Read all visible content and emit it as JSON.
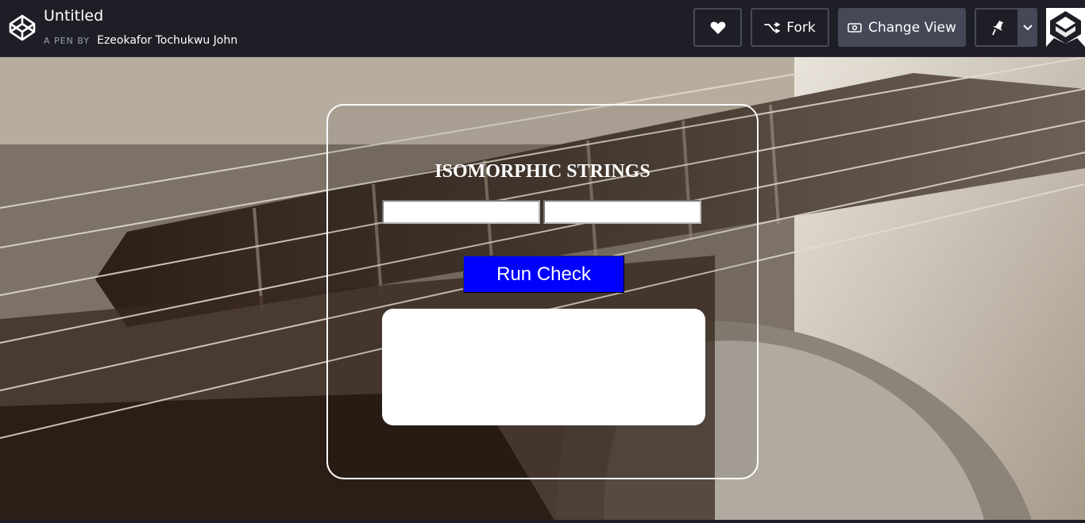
{
  "header": {
    "title": "Untitled",
    "by_label": "A PEN BY",
    "author": "Ezeokafor Tochukwu John",
    "logo_icon": "codepen-logo-icon",
    "buttons": {
      "heart_icon": "heart-icon",
      "fork_label": "Fork",
      "fork_icon": "fork-icon",
      "change_view_label": "Change View",
      "change_view_icon": "eye-icon",
      "pin_icon": "pin-icon",
      "dropdown_icon": "chevron-down-icon"
    },
    "avatar_icon": "codepen-avatar-icon"
  },
  "app": {
    "title": "ISOMORPHIC STRINGS",
    "input_one_value": "",
    "input_two_value": "",
    "run_button_label": "Run Check",
    "result_text": "",
    "button_color": "#0000ff"
  },
  "colors": {
    "topbar_bg": "#1e1f26",
    "button_border": "#474954",
    "change_view_bg": "#444857"
  }
}
